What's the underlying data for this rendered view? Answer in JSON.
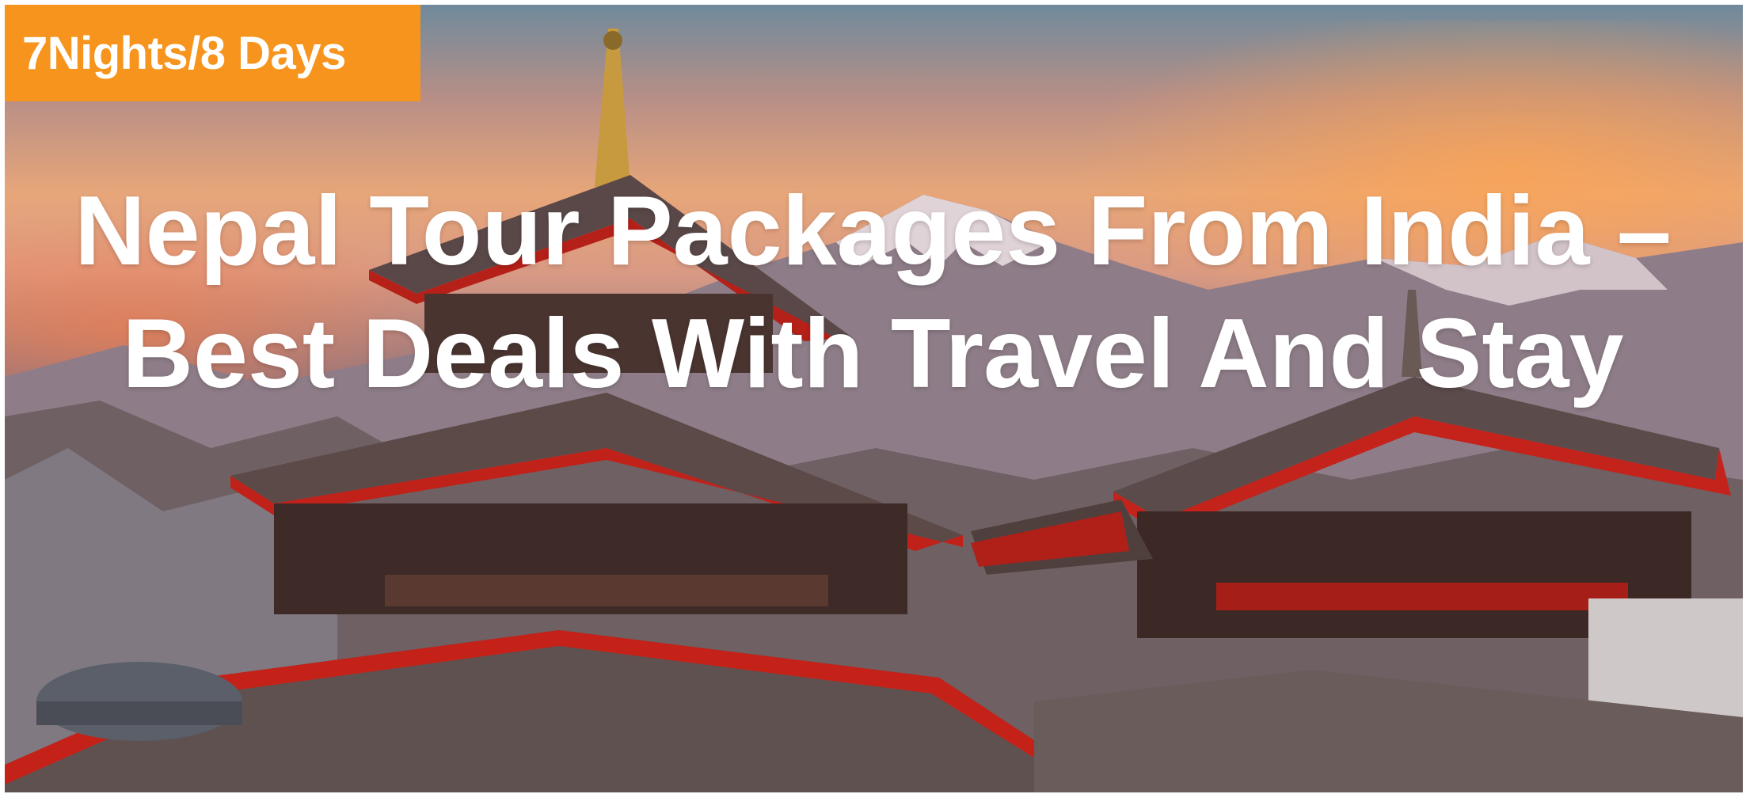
{
  "badge": {
    "text": "7Nights/8 Days",
    "color": "#f7941d"
  },
  "headline": {
    "line1": "Nepal Tour Packages From India –",
    "line2": "Best Deals With Travel And Stay"
  },
  "background": {
    "description_icon": "pagoda-temple-mountains-photo",
    "accent_red": "#c0201a",
    "sky_orange": "#f0a060"
  }
}
